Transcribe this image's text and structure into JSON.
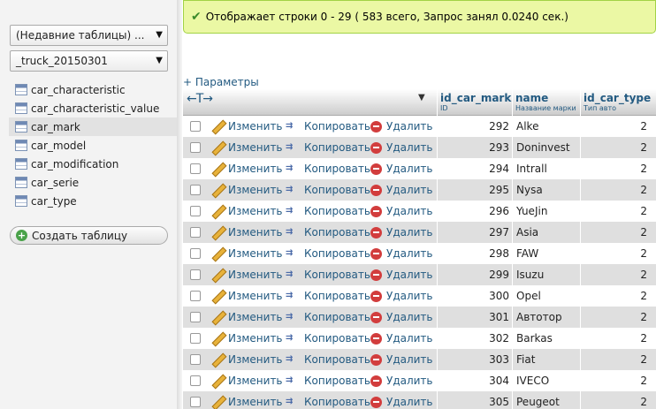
{
  "sidebar": {
    "recent_tables": "(Недавние таблицы) ...",
    "database": "_truck_20150301",
    "tables": [
      {
        "name": "car_characteristic"
      },
      {
        "name": "car_characteristic_value"
      },
      {
        "name": "car_mark",
        "active": true
      },
      {
        "name": "car_model"
      },
      {
        "name": "car_modification"
      },
      {
        "name": "car_serie"
      },
      {
        "name": "car_type"
      }
    ],
    "create_table": "Создать таблицу"
  },
  "message": {
    "text": "Отображает строки 0 - 29 ( 583 всего, Запрос занял 0.0240 сек.)"
  },
  "params_link": "+ Параметры",
  "table": {
    "arrows": "←T→",
    "columns": [
      {
        "name": "id_car_mark",
        "comment": "ID"
      },
      {
        "name": "name",
        "comment": "Название марки"
      },
      {
        "name": "id_car_type",
        "comment": "Тип авто"
      }
    ],
    "actions": {
      "edit": "Изменить",
      "copy": "Копировать",
      "delete": "Удалить"
    },
    "rows": [
      {
        "id": "292",
        "name": "Alke",
        "type": "2"
      },
      {
        "id": "293",
        "name": "Doninvest",
        "type": "2"
      },
      {
        "id": "294",
        "name": "Intrall",
        "type": "2"
      },
      {
        "id": "295",
        "name": "Nysa",
        "type": "2"
      },
      {
        "id": "296",
        "name": "YueJin",
        "type": "2"
      },
      {
        "id": "297",
        "name": "Asia",
        "type": "2"
      },
      {
        "id": "298",
        "name": "FAW",
        "type": "2"
      },
      {
        "id": "299",
        "name": "Isuzu",
        "type": "2"
      },
      {
        "id": "300",
        "name": "Opel",
        "type": "2"
      },
      {
        "id": "301",
        "name": "Автотор",
        "type": "2"
      },
      {
        "id": "302",
        "name": "Barkas",
        "type": "2"
      },
      {
        "id": "303",
        "name": "Fiat",
        "type": "2"
      },
      {
        "id": "304",
        "name": "IVECO",
        "type": "2"
      },
      {
        "id": "305",
        "name": "Peugeot",
        "type": "2"
      }
    ]
  },
  "colors": {
    "link": "#235a81",
    "success_bg": "#ebf8a4",
    "success_border": "#a2d246",
    "row_even": "#dfdfdf"
  }
}
